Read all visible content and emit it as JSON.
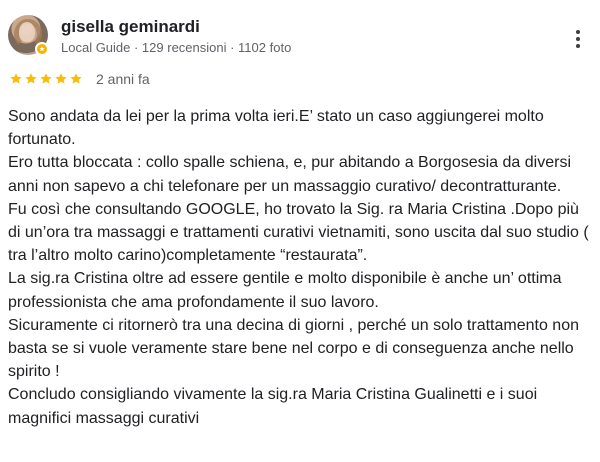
{
  "reviewer": {
    "name": "gisella geminardi",
    "meta": "Local Guide · 129 recensioni · 1102 foto"
  },
  "rating": {
    "stars": 5,
    "date": "2 anni fa",
    "star_color": "#fbbc04"
  },
  "review": {
    "paragraphs": [
      "Sono andata da lei per la prima volta ieri.E’ stato un caso aggiungerei molto fortunato.",
      "Ero tutta bloccata : collo spalle schiena, e, pur abitando a Borgosesia da diversi anni non sapevo a chi telefonare per un massaggio curativo/ decontratturante.",
      "Fu così che consultando GOOGLE, ho trovato la Sig. ra Maria Cristina .Dopo più di un’ora tra massaggi e trattamenti curativi vietnamiti, sono uscita dal suo studio ( tra l’altro molto carino)completamente “restaurata”.",
      "La sig.ra Cristina oltre ad essere gentile e molto disponibile è anche un’ ottima professionista che ama profondamente il suo lavoro.",
      "Sicuramente ci ritornerò tra una decina di giorni , perché un solo trattamento non basta se si vuole veramente stare bene nel corpo e di conseguenza anche nello spirito !",
      "Concludo consigliando vivamente la sig.ra Maria Cristina Gualinetti e i suoi magnifici massaggi curativi"
    ]
  },
  "icons": {
    "more": "more-vertical-icon",
    "badge": "local-guide-badge-icon",
    "star": "star-icon"
  }
}
